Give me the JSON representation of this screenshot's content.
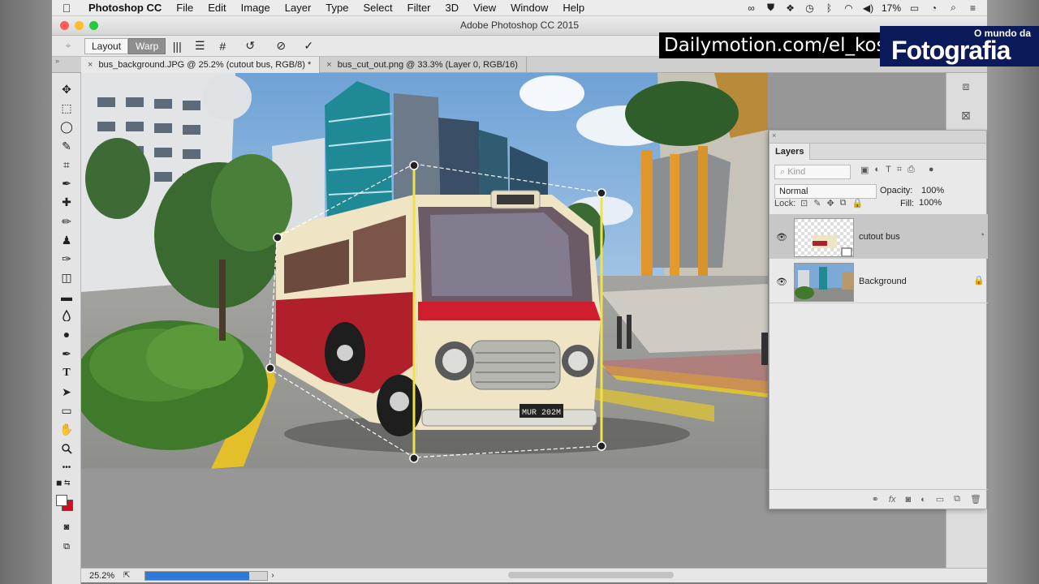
{
  "menubar": {
    "app_name": "Photoshop CC",
    "items": [
      "File",
      "Edit",
      "Image",
      "Layer",
      "Type",
      "Select",
      "Filter",
      "3D",
      "View",
      "Window",
      "Help"
    ],
    "battery": "17%",
    "icons": [
      "creative-cloud-icon",
      "shield-icon",
      "dropbox-icon",
      "time-machine-icon",
      "bluetooth-icon",
      "wifi-icon",
      "volume-icon",
      "battery-icon",
      "clock-icon",
      "search-icon",
      "list-icon"
    ]
  },
  "window": {
    "title": "Adobe Photoshop CC 2015"
  },
  "options_bar": {
    "mode_layout": "Layout",
    "mode_warp": "Warp",
    "icons": [
      "split-vertical-icon",
      "split-horizontal-icon",
      "split-cross-icon",
      "reset-icon",
      "cancel-icon",
      "commit-icon"
    ],
    "glyphs": [
      "|||",
      "☰",
      "#",
      "↺",
      "⊘",
      "✓"
    ]
  },
  "watermarks": {
    "dailymotion": "Dailymotion.com/el_kosta",
    "brand_small": "O mundo da",
    "brand_big": "Fotografia"
  },
  "tabs": [
    {
      "label": "bus_background.JPG @ 25.2% (cutout bus, RGB/8) *",
      "active": true
    },
    {
      "label": "bus_cut_out.png @ 33.3% (Layer 0, RGB/16)",
      "active": false
    }
  ],
  "tools": {
    "names": [
      "move-tool-icon",
      "marquee-tool-icon",
      "lasso-tool-icon",
      "quick-select-tool-icon",
      "crop-tool-icon",
      "eyedropper-tool-icon",
      "healing-tool-icon",
      "brush-tool-icon",
      "stamp-tool-icon",
      "history-brush-tool-icon",
      "eraser-tool-icon",
      "gradient-tool-icon",
      "blur-tool-icon",
      "dodge-tool-icon",
      "pen-tool-icon",
      "type-tool-icon",
      "path-select-tool-icon",
      "rectangle-tool-icon",
      "hand-tool-icon",
      "zoom-tool-icon",
      "more-tools-icon"
    ],
    "glyphs": [
      "✥",
      "⬚",
      "◯",
      "✎",
      "⌗",
      "✒",
      "✚",
      "✏",
      "♟",
      "✑",
      "◫",
      "▬",
      "💧",
      "●",
      "✒",
      "T",
      "➤",
      "▭",
      "✋",
      "🔍",
      "•••"
    ]
  },
  "status": {
    "zoom": "25.2%",
    "progress": 0.85
  },
  "layers_panel": {
    "tab": "Layers",
    "kind_placeholder": "Kind",
    "blend_mode": "Normal",
    "opacity_label": "Opacity:",
    "opacity_value": "100%",
    "lock_label": "Lock:",
    "fill_label": "Fill:",
    "fill_value": "100%",
    "layers": [
      {
        "name": "cutout bus",
        "selected": true
      },
      {
        "name": "Background",
        "selected": false
      }
    ],
    "footer_icons": [
      "link-icon",
      "fx-icon",
      "mask-icon",
      "adjustment-icon",
      "folder-icon",
      "new-layer-icon",
      "trash-icon"
    ]
  },
  "colors": {
    "bus_red": "#b0202a",
    "bus_cream": "#efe4c4",
    "sky": "#8bb7e0",
    "selection_blue": "#2f7ad9"
  }
}
